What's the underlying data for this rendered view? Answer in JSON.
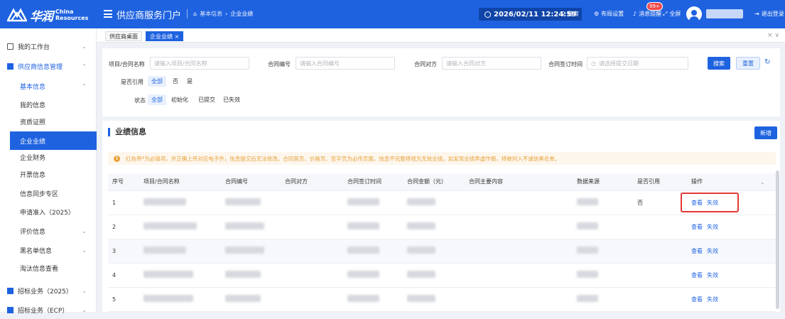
{
  "brand": {
    "cn": "华润",
    "en1": "China",
    "en2": "Resources"
  },
  "header": {
    "portal_title": "供应商服务门户",
    "crumb": [
      "基本信息",
      "企业业绩"
    ],
    "datetime": "2026/02/11 12:24:59",
    "search": "搜索",
    "layout": "布局设置",
    "messages": "消息提醒",
    "badge": "99+",
    "fullscreen": "全屏",
    "logout": "退出登录",
    "accent": "#1e62e0"
  },
  "sidebar": {
    "items": [
      {
        "label": "我的工作台",
        "icon": "home-icon"
      },
      {
        "label": "供应商信息管理",
        "icon": "file-icon"
      },
      {
        "label": "基本信息"
      },
      {
        "label": "我的信息"
      },
      {
        "label": "资质证照"
      },
      {
        "label": "企业业绩"
      },
      {
        "label": "企业财务"
      },
      {
        "label": "开票信息"
      },
      {
        "label": "信息同步专区"
      },
      {
        "label": "申请准入（2025）"
      },
      {
        "label": "评价信息"
      },
      {
        "label": "黑名单信息"
      },
      {
        "label": "淘汰信息查看"
      },
      {
        "label": "招标业务（2025）",
        "icon": "bid-icon"
      },
      {
        "label": "招标业务（ECP）",
        "icon": "bid-icon"
      }
    ]
  },
  "tabs": [
    "供应商桌面",
    "企业业绩 ×"
  ],
  "filter": {
    "project_label": "项目/合同名称",
    "project_ph": "请输入项目/合同名称",
    "contract_no_label": "合同编号",
    "contract_no_ph": "请输入合同编号",
    "party_label": "合同对方",
    "party_ph": "请输入合同对方",
    "date_label": "合同签订时间",
    "date_ph": "请选择提交日期",
    "search_btn": "搜索",
    "reset_btn": "重置",
    "cited_label": "是否引用",
    "cited_opts": [
      "全部",
      "否",
      "是"
    ],
    "status_label": "状态",
    "status_opts": [
      "全部",
      "初始化",
      "已提交",
      "已失效"
    ]
  },
  "section": {
    "title": "业绩信息",
    "add_btn": "新增",
    "notice": "红色带*为必填项，并正确上传对应电子件，信息提交后无法修改。合同首页、价格页、签字页为必传页面，信息不完整将视为无效业绩。如发现业绩弄虚作假，将被列入不诚信黑名单。"
  },
  "table": {
    "headers": [
      "序号",
      "项目/合同名称",
      "合同编号",
      "合同对方",
      "合同签订时间",
      "合同金额（元）",
      "合同主要内容",
      "数据来源",
      "是否引用",
      "操作"
    ],
    "rows": [
      {
        "no": "1",
        "cited": "否",
        "view": "查看",
        "invalid": "失效"
      },
      {
        "no": "2",
        "cited": "",
        "view": "查看",
        "invalid": "失效"
      },
      {
        "no": "3",
        "cited": "",
        "view": "查看",
        "invalid": "失效"
      },
      {
        "no": "4",
        "cited": "",
        "view": "查看",
        "invalid": "失效"
      },
      {
        "no": "5",
        "cited": "",
        "view": "查看",
        "invalid": "失效"
      }
    ]
  }
}
